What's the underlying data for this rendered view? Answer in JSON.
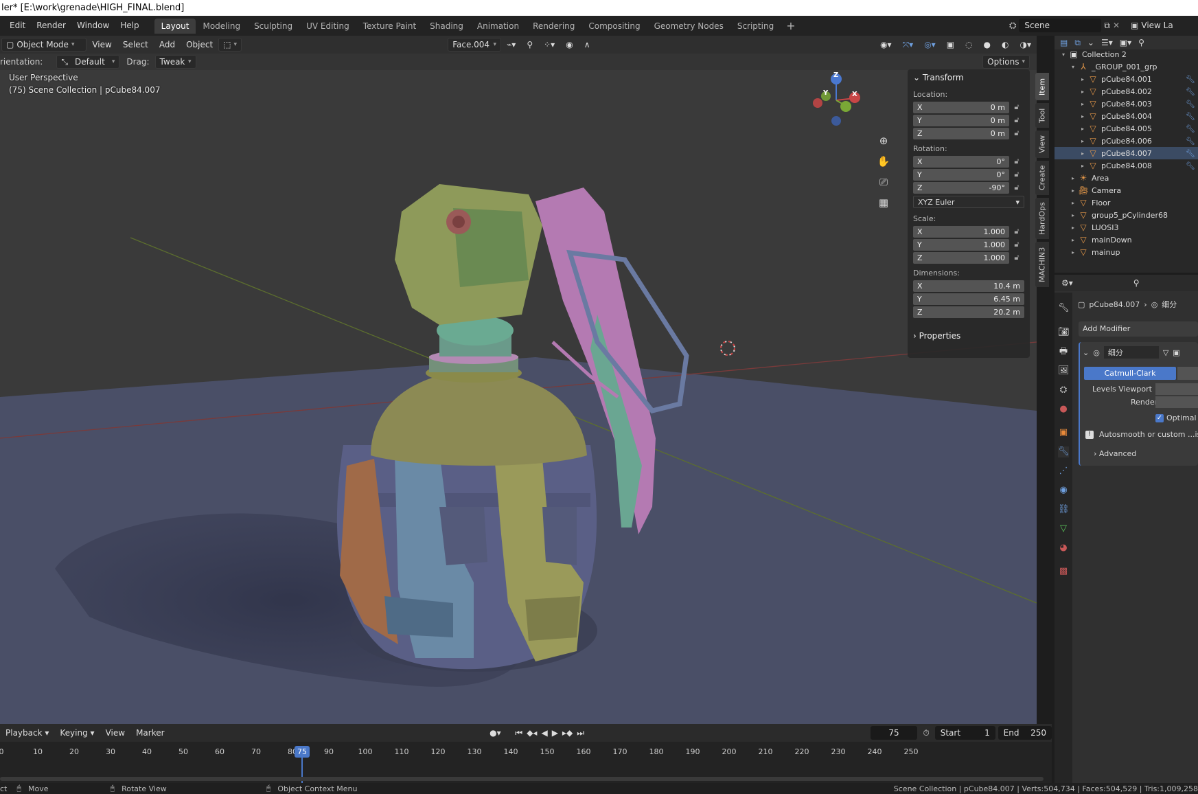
{
  "title": "ler* [E:\\work\\grenade\\HIGH_FINAL.blend]",
  "menu": [
    "Edit",
    "Render",
    "Window",
    "Help"
  ],
  "workspaces": [
    "Layout",
    "Modeling",
    "Sculpting",
    "UV Editing",
    "Texture Paint",
    "Shading",
    "Animation",
    "Rendering",
    "Compositing",
    "Geometry Nodes",
    "Scripting"
  ],
  "active_workspace": "Layout",
  "scene": {
    "label": "Scene",
    "view_layer": "View La"
  },
  "viewport_header": {
    "mode": "Object Mode",
    "menus": [
      "View",
      "Select",
      "Add",
      "Object"
    ],
    "face_dropdown": "Face.004",
    "options": "Options"
  },
  "tool_settings": {
    "orientation_label": "rientation:",
    "orientation_value": "Default",
    "drag_label": "Drag:",
    "drag_value": "Tweak"
  },
  "viewport_overlay": {
    "perspective": "User Perspective",
    "collection": "(75) Scene Collection | pCube84.007"
  },
  "gizmo": {
    "x": "X",
    "y": "Y",
    "z": "Z"
  },
  "transform": {
    "header": "Transform",
    "location_label": "Location:",
    "location": [
      {
        "axis": "X",
        "value": "0 m"
      },
      {
        "axis": "Y",
        "value": "0 m"
      },
      {
        "axis": "Z",
        "value": "0 m"
      }
    ],
    "rotation_label": "Rotation:",
    "rotation": [
      {
        "axis": "X",
        "value": "0°"
      },
      {
        "axis": "Y",
        "value": "0°"
      },
      {
        "axis": "Z",
        "value": "-90°"
      }
    ],
    "rotation_mode": "XYZ Euler",
    "scale_label": "Scale:",
    "scale": [
      {
        "axis": "X",
        "value": "1.000"
      },
      {
        "axis": "Y",
        "value": "1.000"
      },
      {
        "axis": "Z",
        "value": "1.000"
      }
    ],
    "dimensions_label": "Dimensions:",
    "dimensions": [
      {
        "axis": "X",
        "value": "10.4 m"
      },
      {
        "axis": "Y",
        "value": "6.45 m"
      },
      {
        "axis": "Z",
        "value": "20.2 m"
      }
    ],
    "properties": "Properties"
  },
  "sidebar_tabs": [
    "Item",
    "Tool",
    "View",
    "Create",
    "HardOps",
    "MACHIN3"
  ],
  "outliner": {
    "items": [
      {
        "name": "Collection 2",
        "indent": 0,
        "tri": "▾",
        "icon": "collection",
        "selected": false
      },
      {
        "name": "_GROUP_001_grp",
        "indent": 1,
        "tri": "▾",
        "icon": "empty",
        "selected": false
      },
      {
        "name": "pCube84.001",
        "indent": 2,
        "tri": "▸",
        "icon": "mesh",
        "selected": false
      },
      {
        "name": "pCube84.002",
        "indent": 2,
        "tri": "▸",
        "icon": "mesh",
        "selected": false
      },
      {
        "name": "pCube84.003",
        "indent": 2,
        "tri": "▸",
        "icon": "mesh",
        "selected": false
      },
      {
        "name": "pCube84.004",
        "indent": 2,
        "tri": "▸",
        "icon": "mesh",
        "selected": false
      },
      {
        "name": "pCube84.005",
        "indent": 2,
        "tri": "▸",
        "icon": "mesh",
        "selected": false
      },
      {
        "name": "pCube84.006",
        "indent": 2,
        "tri": "▸",
        "icon": "mesh",
        "selected": false
      },
      {
        "name": "pCube84.007",
        "indent": 2,
        "tri": "▸",
        "icon": "mesh",
        "selected": true
      },
      {
        "name": "pCube84.008",
        "indent": 2,
        "tri": "▸",
        "icon": "mesh",
        "selected": false
      },
      {
        "name": "Area",
        "indent": 1,
        "tri": "▸",
        "icon": "light",
        "selected": false
      },
      {
        "name": "Camera",
        "indent": 1,
        "tri": "▸",
        "icon": "camera",
        "selected": false
      },
      {
        "name": "Floor",
        "indent": 1,
        "tri": "▸",
        "icon": "mesh",
        "selected": false
      },
      {
        "name": "group5_pCylinder68",
        "indent": 1,
        "tri": "▸",
        "icon": "mesh",
        "selected": false
      },
      {
        "name": "LUOSI3",
        "indent": 1,
        "tri": "▸",
        "icon": "mesh",
        "selected": false
      },
      {
        "name": "mainDown",
        "indent": 1,
        "tri": "▸",
        "icon": "mesh",
        "selected": false
      },
      {
        "name": "mainup",
        "indent": 1,
        "tri": "▸",
        "icon": "mesh",
        "selected": false
      }
    ]
  },
  "properties_panel": {
    "object_name": "pCube84.007",
    "modifier_crumb": "细分",
    "add_modifier": "Add Modifier",
    "modifier_name": "细分",
    "subdiv_type": "Catmull-Clark",
    "levels_viewport": "Levels Viewport",
    "render": "Render",
    "optimal": "Optimal D",
    "autosmooth": "Autosmooth or custom ...isab",
    "advanced": "Advanced"
  },
  "timeline": {
    "menus": [
      "Playback",
      "Keying",
      "View",
      "Marker"
    ],
    "current_frame": "75",
    "start_label": "Start",
    "start": "1",
    "end_label": "End",
    "end": "250",
    "ticks": [
      "0",
      "10",
      "20",
      "30",
      "40",
      "50",
      "60",
      "70",
      "80",
      "90",
      "100",
      "110",
      "120",
      "130",
      "140",
      "150",
      "160",
      "170",
      "180",
      "190",
      "200",
      "210",
      "220",
      "230",
      "240",
      "250"
    ]
  },
  "statusbar": {
    "select": "ct",
    "move": "Move",
    "rotate": "Rotate View",
    "context": "Object Context Menu",
    "stats": "Scene Collection | pCube84.007 | Verts:504,734 | Faces:504,529 | Tris:1,009,258"
  },
  "colors": {
    "accent": "#4a78c9",
    "selected_row": "#3b4b63",
    "floor": "#4a5068",
    "grid": "#3d3d3d"
  }
}
